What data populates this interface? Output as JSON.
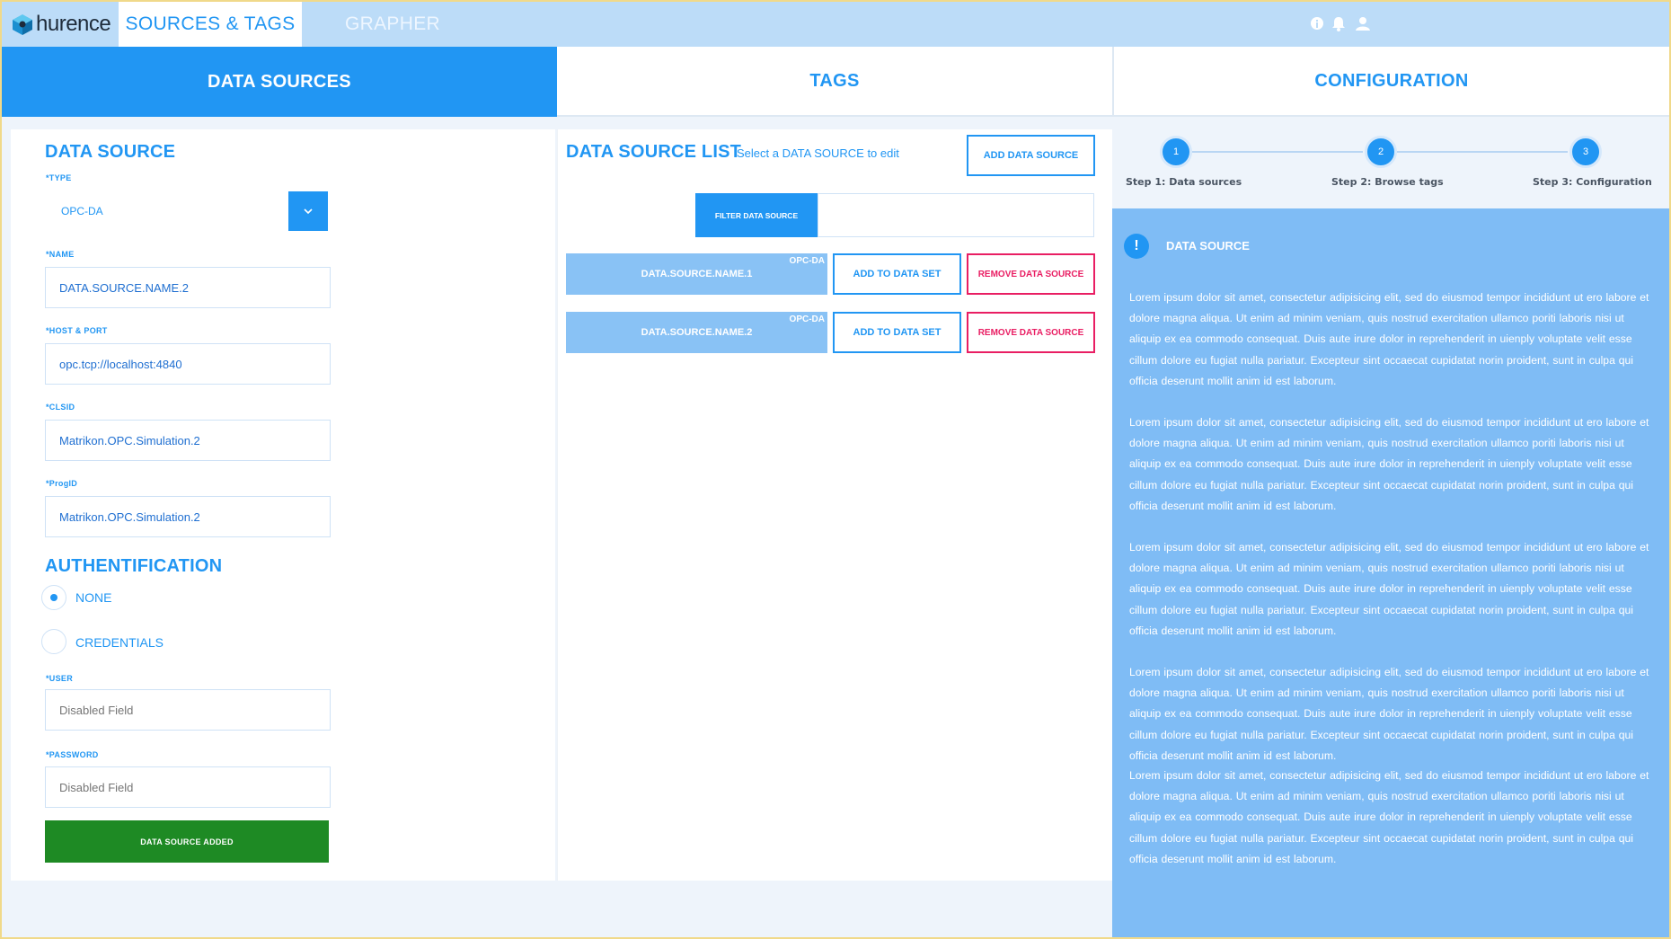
{
  "app": {
    "brand": "hurence",
    "nav_tabs": [
      "SOURCES & TAGS",
      "GRAPHER"
    ],
    "icons": [
      "info-icon",
      "bell-icon",
      "user-icon"
    ]
  },
  "sections": {
    "data_sources": "DATA SOURCES",
    "tags": "TAGS",
    "configuration": "CONFIGURATION"
  },
  "form": {
    "title": "DATA SOURCE",
    "type_label": "*TYPE",
    "type_value": "OPC-DA",
    "name_label": "*NAME",
    "name_value": "DATA.SOURCE.NAME.2",
    "host_label": "*HOST & PORT",
    "host_value": "opc.tcp://localhost:4840",
    "clsid_label": "*CLSID",
    "clsid_value": "Matrikon.OPC.Simulation.2",
    "progid_label": "*ProgID",
    "progid_value": "Matrikon.OPC.Simulation.2",
    "auth_title": "AUTHENTIFICATION",
    "auth_none": "NONE",
    "auth_credentials": "CREDENTIALS",
    "user_label": "*USER",
    "user_placeholder": "Disabled Field",
    "password_label": "*PASSWORD",
    "password_placeholder": "Disabled Field",
    "submit_label": "DATA SOURCE ADDED"
  },
  "list": {
    "title": "DATA SOURCE LIST",
    "subtitle": "Select a DATA SOURCE to edit",
    "add_button": "ADD DATA SOURCE",
    "filter_button": "FILTER DATA SOURCE",
    "rows": [
      {
        "name": "DATA.SOURCE.NAME.1",
        "type": "OPC-DA",
        "add": "ADD TO DATA SET",
        "remove": "REMOVE DATA SOURCE"
      },
      {
        "name": "DATA.SOURCE.NAME.2",
        "type": "OPC-DA",
        "add": "ADD TO DATA SET",
        "remove": "REMOVE DATA SOURCE"
      }
    ]
  },
  "stepper": {
    "steps": [
      {
        "number": "1",
        "label": "Step 1: Data sources"
      },
      {
        "number": "2",
        "label": "Step 2: Browse tags"
      },
      {
        "number": "3",
        "label": "Step 3: Configuration"
      }
    ]
  },
  "info": {
    "title": "DATA SOURCE",
    "paragraphs": [
      "Lorem ipsum dolor sit amet, consectetur adipisicing elit, sed do eiusmod tempor incididunt ut ero labore et dolore magna aliqua. Ut enim ad minim veniam, quis nostrud exercitation ullamco poriti laboris nisi ut aliquip ex ea commodo consequat. Duis aute irure dolor in reprehenderit in uienply voluptate velit esse cillum dolore eu fugiat nulla pariatur. Excepteur sint occaecat cupidatat norin proident, sunt in culpa qui officia deserunt mollit anim id est laborum.",
      "Lorem ipsum dolor sit amet, consectetur adipisicing elit, sed do eiusmod tempor incididunt ut ero labore et dolore magna aliqua. Ut enim ad minim veniam, quis nostrud exercitation ullamco poriti laboris nisi ut aliquip ex ea commodo consequat. Duis aute irure dolor in reprehenderit in uienply voluptate velit esse cillum dolore eu fugiat nulla pariatur. Excepteur sint occaecat cupidatat norin proident, sunt in culpa qui officia deserunt mollit anim id est laborum.",
      "Lorem ipsum dolor sit amet, consectetur adipisicing elit, sed do eiusmod tempor incididunt ut ero labore et dolore magna aliqua. Ut enim ad minim veniam, quis nostrud exercitation ullamco poriti laboris nisi ut aliquip ex ea commodo consequat. Duis aute irure dolor in reprehenderit in uienply voluptate velit esse cillum dolore eu fugiat nulla pariatur. Excepteur sint occaecat cupidatat norin proident, sunt in culpa qui officia deserunt mollit anim id est laborum.",
      "Lorem ipsum dolor sit amet, consectetur adipisicing elit, sed do eiusmod tempor incididunt ut ero labore et dolore magna aliqua. Ut enim ad minim veniam, quis nostrud exercitation ullamco poriti laboris nisi ut aliquip ex ea commodo consequat. Duis aute irure dolor in reprehenderit in uienply voluptate velit esse cillum dolore eu fugiat nulla pariatur. Excepteur sint occaecat cupidatat norin proident, sunt in culpa qui officia deserunt mollit anim id est laborum.",
      "Lorem ipsum dolor sit amet, consectetur adipisicing elit, sed do eiusmod tempor incididunt ut ero labore et dolore magna aliqua. Ut enim ad minim veniam, quis nostrud exercitation ullamco poriti laboris nisi ut aliquip ex ea commodo consequat. Duis aute irure dolor in reprehenderit in uienply voluptate velit esse cillum dolore eu fugiat nulla pariatur. Excepteur sint occaecat cupidatat norin proident, sunt in culpa qui officia deserunt mollit anim id est laborum."
    ]
  },
  "colors": {
    "accent": "#2196f3",
    "topbar": "#bcdcf8",
    "info_panel": "#7fbcf5",
    "success": "#1e8a24",
    "danger": "#e91e63"
  }
}
